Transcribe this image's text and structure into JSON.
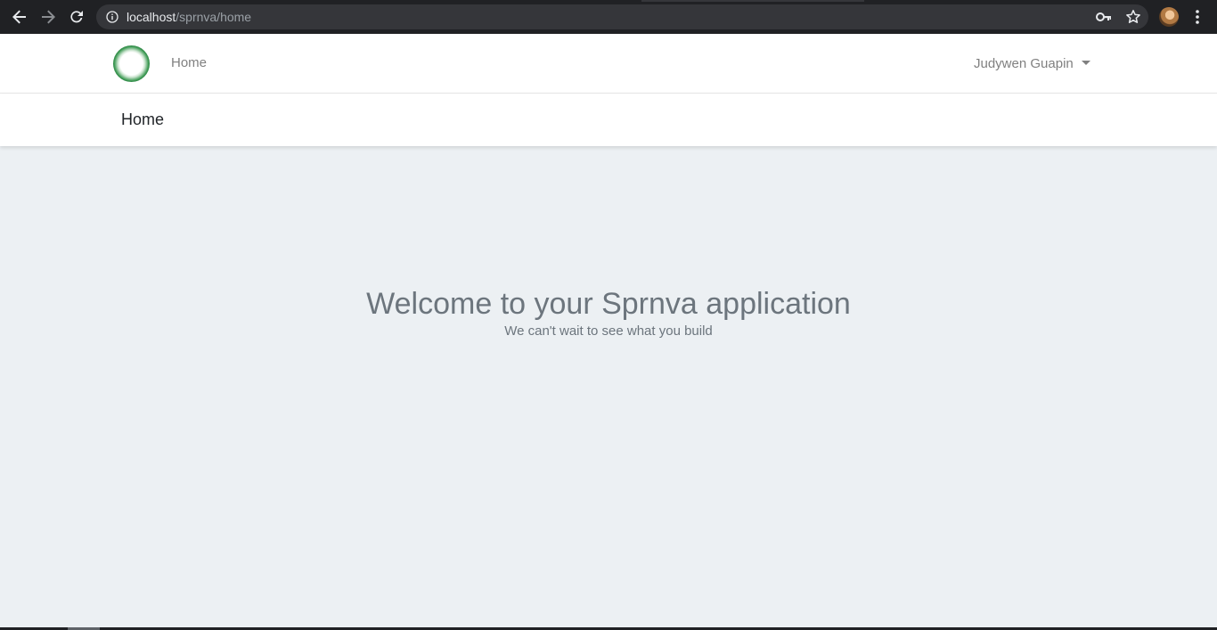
{
  "browser": {
    "url_host": "localhost",
    "url_path": "/sprnva/home",
    "icons": {
      "back": "arrow-left-icon",
      "forward": "arrow-right-icon",
      "reload": "reload-icon",
      "info": "info-icon",
      "key": "key-icon",
      "star": "star-icon",
      "menu": "more-vert-icon"
    }
  },
  "navbar": {
    "home_link": "Home",
    "user_name": "Judywen Guapin",
    "logo": "brand-logo-ring"
  },
  "page_header": {
    "title": "Home"
  },
  "main": {
    "heading": "Welcome to your Sprnva application",
    "subheading": "We can't wait to see what you build"
  },
  "colors": {
    "browser_bg": "#202124",
    "omnibox_bg": "#35363a",
    "page_bg": "#ecf0f3",
    "muted_text": "#6c757d",
    "brand_green": "#0e5a28"
  }
}
